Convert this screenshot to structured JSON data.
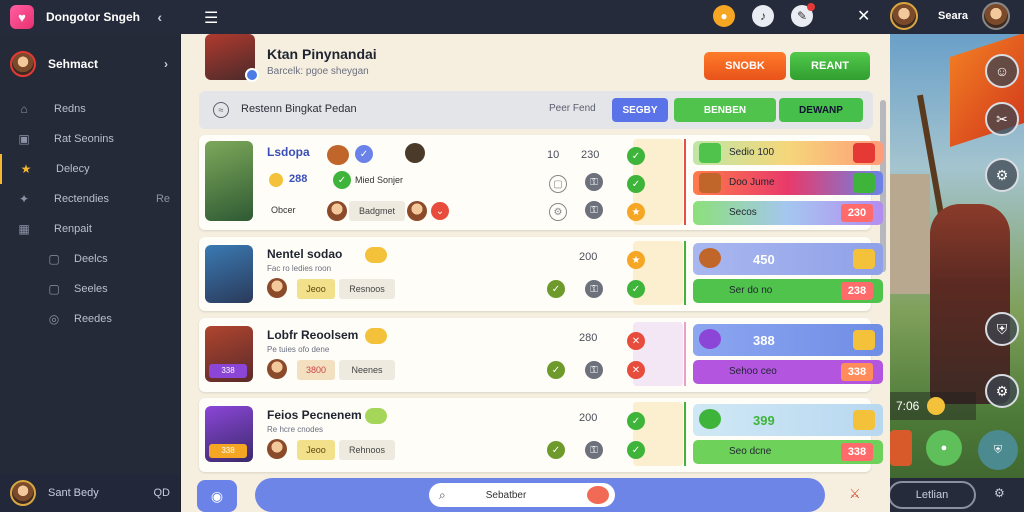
{
  "app": {
    "title": "Dongotor Sngeh"
  },
  "topbar": {
    "user_name": "Seara"
  },
  "sidebar": {
    "profile_name": "Sehmact",
    "items": [
      {
        "label": "Redns",
        "icon": "home-icon"
      },
      {
        "label": "Rat Seonins",
        "icon": "briefcase-icon"
      },
      {
        "label": "Delecy",
        "icon": "star-icon"
      },
      {
        "label": "Rectendies",
        "extra": "Re",
        "icon": "pin-icon"
      },
      {
        "label": "Renpait",
        "icon": "grid-icon"
      }
    ],
    "sub_items": [
      "Deelcs",
      "Seeles",
      "Reedes"
    ],
    "footer_name": "Sant Bedy",
    "footer_num": "QD"
  },
  "header": {
    "title": "Ktan Pinynandai",
    "subtitle": "Barcelk: pgoe sheygan",
    "btn_primary": "SNOBK",
    "btn_secondary": "REANT"
  },
  "toolbar": {
    "label": "Restenn Bingkat Pedan",
    "stat": "Peer Fend",
    "btn_blue": "SEGBY",
    "btn_green": "BENBEN",
    "btn_green2": "DEWANP"
  },
  "rows": [
    {
      "name": "Lsdopa",
      "line2": "288",
      "line2_text": "Mied Sonjer",
      "line3_text": "Obcer",
      "line3_tag": "Badgmet",
      "val1": "10",
      "val2": "230",
      "rewards": [
        {
          "label": "Sedio 100"
        },
        {
          "label": "Doo Jume"
        },
        {
          "label": "Secos",
          "num": "230"
        }
      ]
    },
    {
      "name": "Nentel sodao",
      "desc": "Fac ro ledies roon",
      "tag": "Jeoo",
      "tag2": "Resnoos",
      "val": "200",
      "reward_top": "450",
      "reward_bottom": {
        "label": "Ser do no",
        "num": "238"
      }
    },
    {
      "name": "Lobfr Reoolsem",
      "desc": "Pe tuies ofo dene",
      "tag": "3800",
      "tag2": "Neenes",
      "val": "280",
      "reward_top": "388",
      "reward_bottom": {
        "label": "Sehoo ceo",
        "num": "338"
      }
    },
    {
      "name": "Feios Pecnenem",
      "desc": "Re hcre cnodes",
      "tag": "Jeoo",
      "tag2": "Rehnoos",
      "val": "200",
      "reward_top": "399",
      "reward_bottom": {
        "label": "Seo dcne",
        "num": "338"
      }
    }
  ],
  "avatar_badges": [
    "338",
    "338"
  ],
  "bottom": {
    "search_text": "Sebatber"
  },
  "art": {
    "money": "7:06",
    "footer_pill": "Letlian"
  }
}
